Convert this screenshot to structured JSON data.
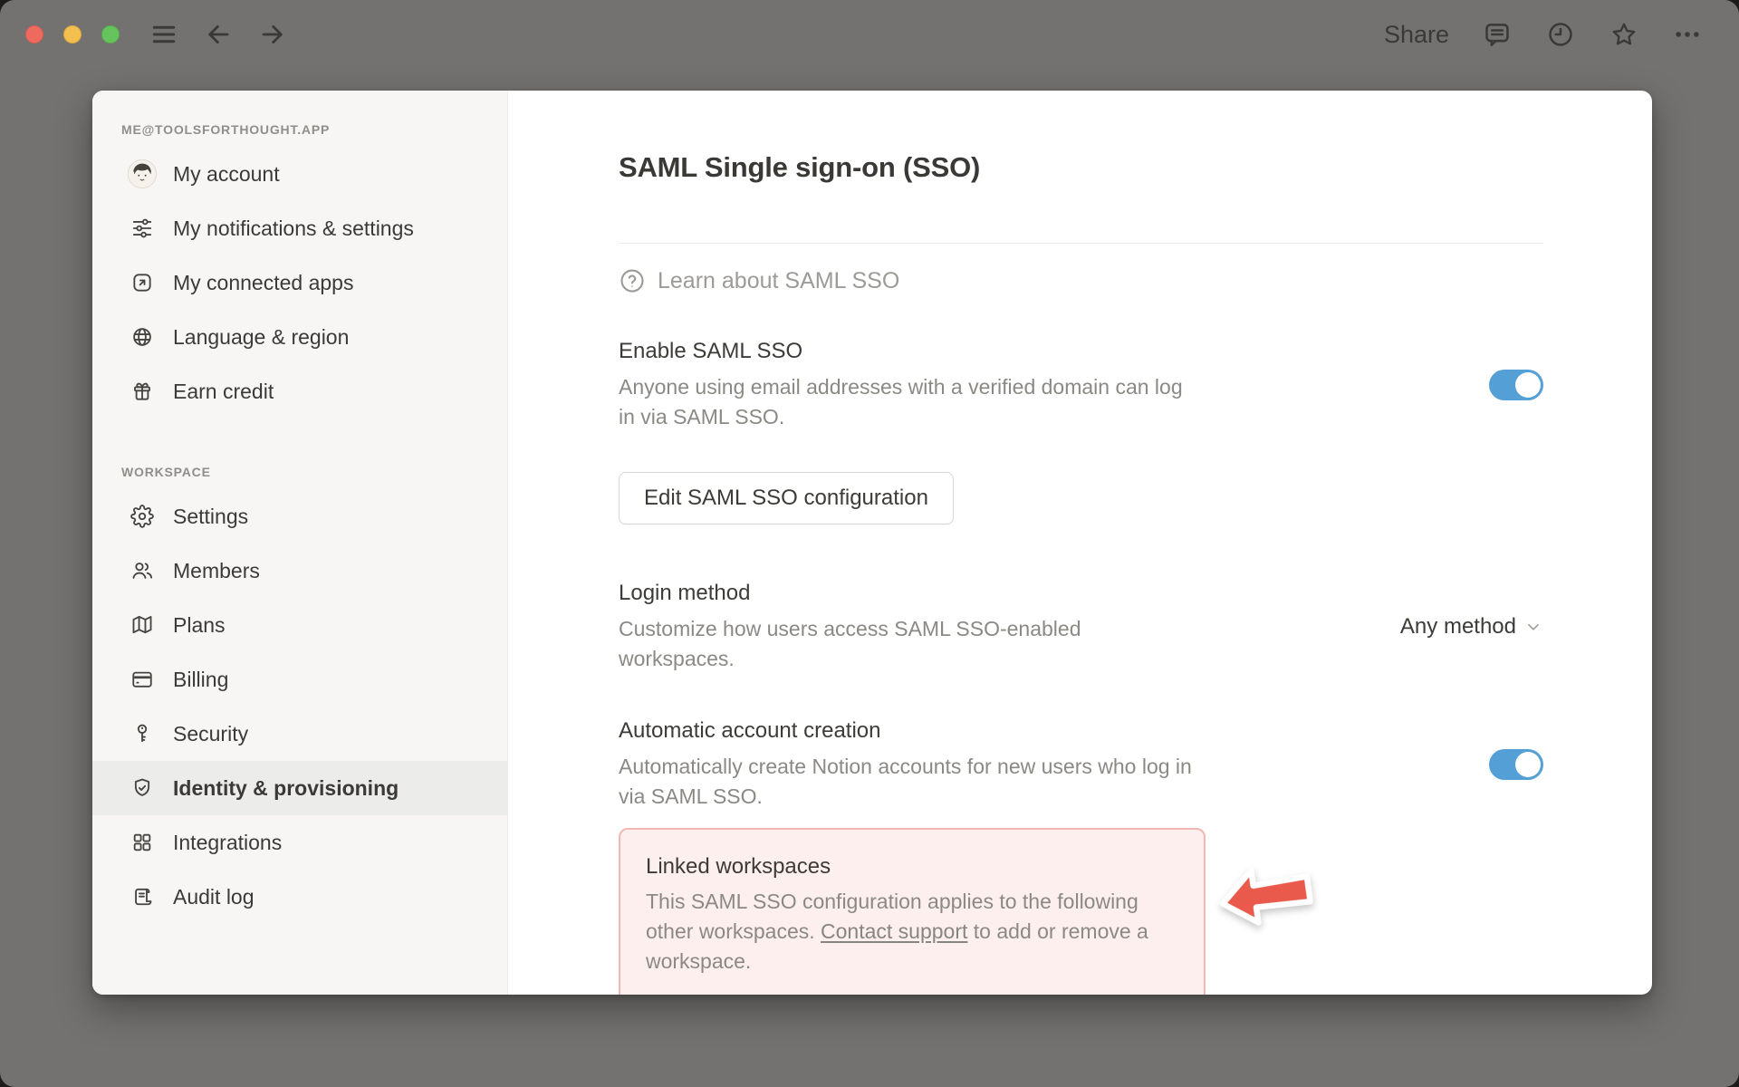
{
  "titlebar": {
    "share_label": "Share",
    "icons": [
      "hamburger-icon",
      "back-arrow-icon",
      "forward-arrow-icon",
      "comment-icon",
      "clock-icon",
      "star-icon",
      "ellipsis-icon"
    ]
  },
  "sidebar": {
    "account_section_label": "ME@TOOLSFORTHOUGHT.APP",
    "account_items": [
      {
        "label": "My account",
        "icon": "avatar"
      },
      {
        "label": "My notifications & settings",
        "icon": "sliders-icon"
      },
      {
        "label": "My connected apps",
        "icon": "external-link-icon"
      },
      {
        "label": "Language & region",
        "icon": "globe-icon"
      },
      {
        "label": "Earn credit",
        "icon": "gift-icon"
      }
    ],
    "workspace_section_label": "WORKSPACE",
    "workspace_items": [
      {
        "label": "Settings",
        "icon": "gear-icon"
      },
      {
        "label": "Members",
        "icon": "members-icon"
      },
      {
        "label": "Plans",
        "icon": "map-icon"
      },
      {
        "label": "Billing",
        "icon": "credit-card-icon"
      },
      {
        "label": "Security",
        "icon": "key-icon"
      },
      {
        "label": "Identity & provisioning",
        "icon": "shield-check-icon",
        "selected": true
      },
      {
        "label": "Integrations",
        "icon": "grid-icon"
      },
      {
        "label": "Audit log",
        "icon": "audit-log-icon"
      }
    ]
  },
  "main": {
    "title": "SAML Single sign-on (SSO)",
    "learn_about": {
      "label": "Learn about SAML SSO",
      "icon": "question-circle-icon"
    },
    "enable_sso": {
      "title": "Enable SAML SSO",
      "description": "Anyone using email addresses with a verified domain can log in via SAML SSO.",
      "toggle_on": true
    },
    "edit_button_label": "Edit SAML SSO configuration",
    "login_method": {
      "title": "Login method",
      "description": "Customize how users access SAML SSO-enabled workspaces.",
      "value": "Any method"
    },
    "auto_account": {
      "title": "Automatic account creation",
      "description": "Automatically create Notion accounts for new users who log in via SAML SSO.",
      "toggle_on": true
    },
    "linked_workspaces": {
      "title": "Linked workspaces",
      "description_before": "This SAML SSO configuration applies to the following other workspaces. ",
      "link_text": "Contact support",
      "description_after": " to add or remove a workspace."
    }
  },
  "colors": {
    "toggle_blue": "#54a0d6",
    "arrow_red": "#e95a4c",
    "pink_bg": "#fdefed",
    "pink_border": "#f1b7b1",
    "traffic_red": "#ee6a5f",
    "traffic_yellow": "#f5bf4f",
    "traffic_green": "#65c45c",
    "window_bg": "#ffffff",
    "sidebar_bg": "#f7f6f4",
    "desktop_bg": "#747270"
  }
}
